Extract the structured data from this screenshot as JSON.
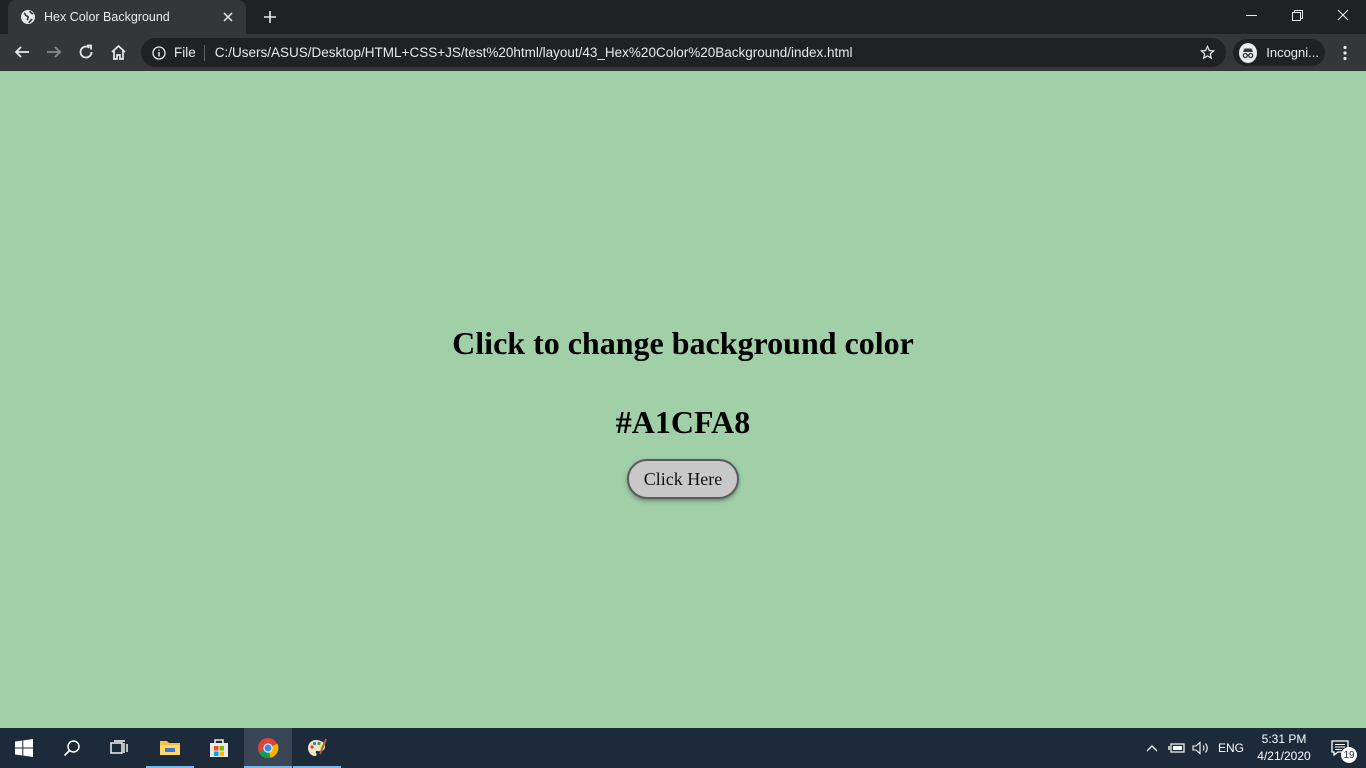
{
  "browser": {
    "tab": {
      "title": "Hex Color Background",
      "favicon": "globe-icon"
    },
    "address": {
      "scheme_label": "File",
      "url": "C:/Users/ASUS/Desktop/HTML+CSS+JS/test%20html/layout/43_Hex%20Color%20Background/index.html"
    },
    "profile": {
      "label": "Incogni..."
    },
    "colors": {
      "frame": "#202124",
      "toolbar": "#35363a",
      "text": "#e8eaed"
    }
  },
  "page": {
    "heading": "Click to change background color",
    "hex_value": "#A1CFA8",
    "button_label": "Click Here",
    "background_color": "#A1CFA8"
  },
  "taskbar": {
    "pinned": [
      "windows-start-icon",
      "search-icon",
      "task-view-icon",
      "file-explorer-icon",
      "store-icon",
      "chrome-icon",
      "paint-icon"
    ],
    "language": "ENG",
    "time": "5:31 PM",
    "date": "4/21/2020",
    "notification_count": "19",
    "colors": {
      "background": "#1d2a3a",
      "accent": "#76b9ed"
    }
  }
}
